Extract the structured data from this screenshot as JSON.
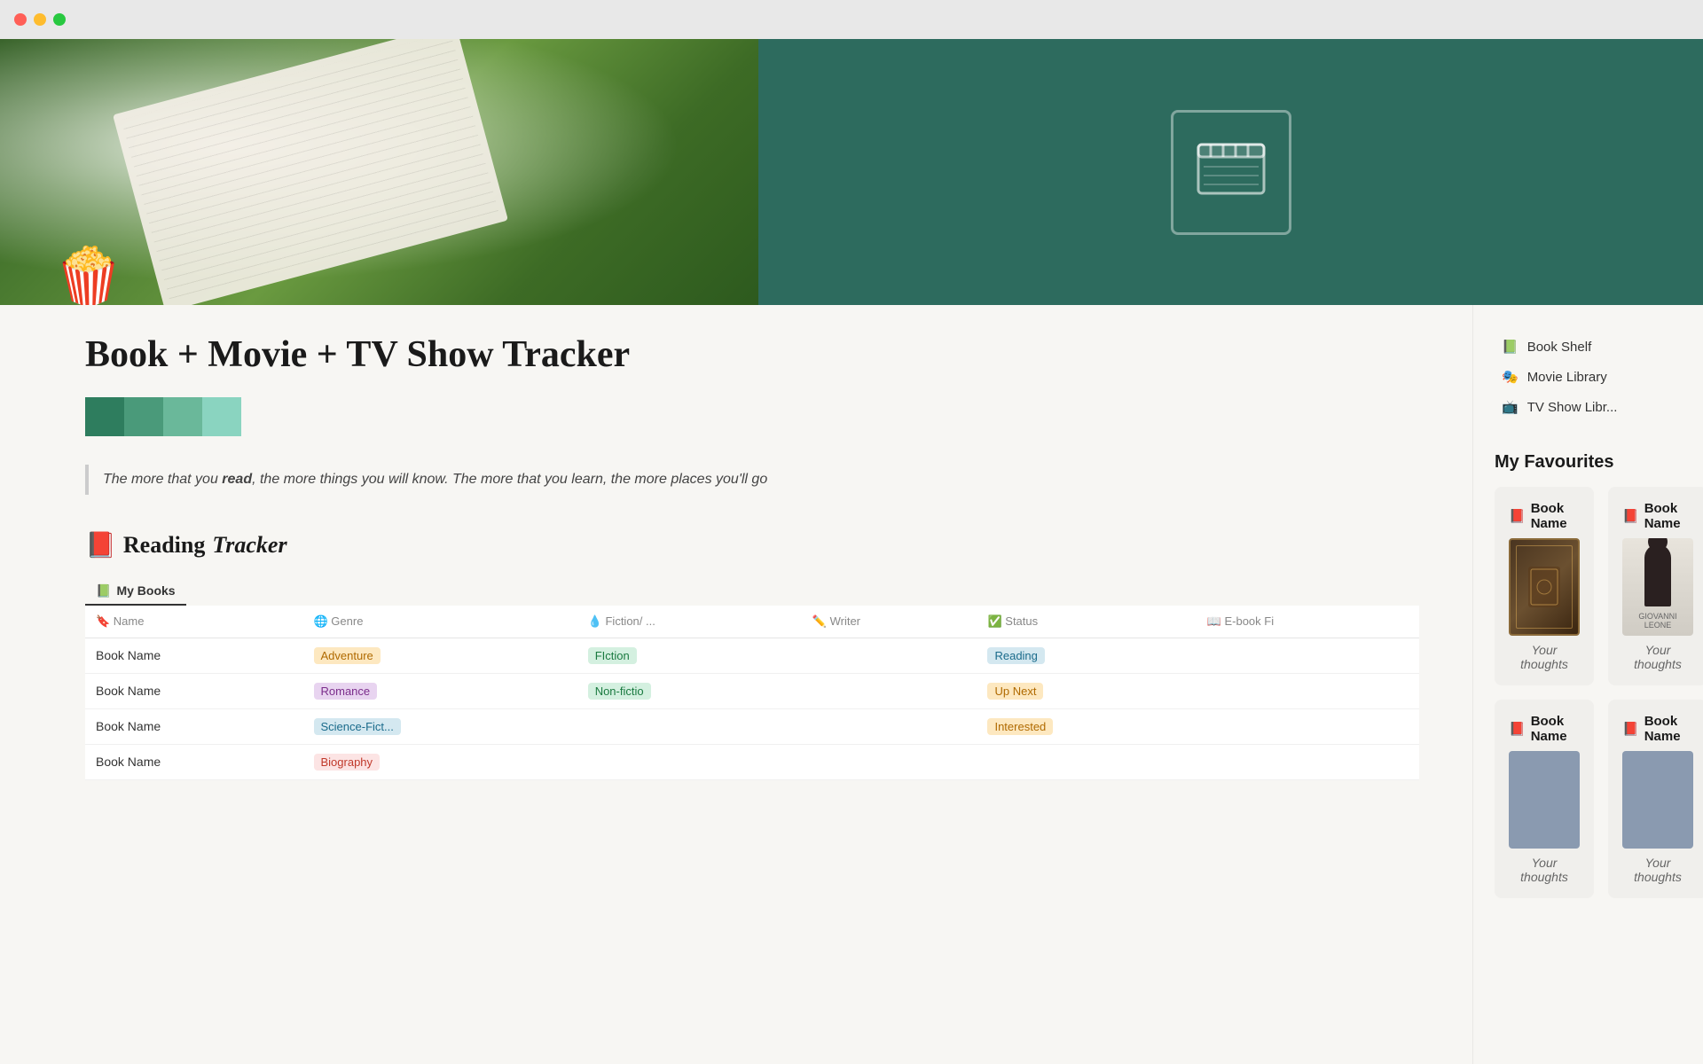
{
  "titlebar": {
    "dots": [
      "red",
      "yellow",
      "green"
    ]
  },
  "hero": {
    "popcorn_emoji": "🍿",
    "movie_icon_label": "🎬"
  },
  "page": {
    "title": "Book  + Movie + TV Show Tracker",
    "color_swatches": [
      "#2e7d5e",
      "#4a9a7a",
      "#6ab89a",
      "#8ad4c0"
    ],
    "quote": "The more that you read, the more things you will know. The more that you learn, the more places you'll go",
    "quote_bold": "read"
  },
  "sidebar_nav": {
    "items": [
      {
        "icon": "📗",
        "label": "Book Shelf"
      },
      {
        "icon": "🎭",
        "label": "Movie Library"
      },
      {
        "icon": "📺",
        "label": "TV Show Libr..."
      }
    ]
  },
  "reading_tracker": {
    "section_emoji": "📕",
    "section_text": "Reading ",
    "section_italic": "Tracker",
    "tab_icon": "📗",
    "tab_label": "My Books",
    "columns": [
      "Name",
      "Genre",
      "Fiction/ ...",
      "Writer",
      "Status",
      "E-book Fi"
    ],
    "col_icons": [
      "🔖",
      "🌐",
      "💧",
      "✏️",
      "✅",
      "📖"
    ],
    "rows": [
      {
        "name": "Book Name",
        "genre": "Adventure",
        "genre_class": "tag-adventure",
        "fiction": "FIction",
        "fiction_class": "tag-fiction",
        "writer": "",
        "status": "Reading",
        "status_class": "tag-reading",
        "ebook": ""
      },
      {
        "name": "Book Name",
        "genre": "Romance",
        "genre_class": "tag-romance",
        "fiction": "Non-fictio",
        "fiction_class": "tag-nonfiction",
        "writer": "",
        "status": "Up Next",
        "status_class": "tag-upnext",
        "ebook": ""
      },
      {
        "name": "Book Name",
        "genre": "Science-Fict...",
        "genre_class": "tag-scifi",
        "fiction": "",
        "fiction_class": "",
        "writer": "",
        "status": "Interested",
        "status_class": "tag-interested",
        "ebook": ""
      },
      {
        "name": "Book Name",
        "genre": "Biography",
        "genre_class": "tag-biography",
        "fiction": "",
        "fiction_class": "",
        "writer": "",
        "status": "",
        "status_class": "",
        "ebook": ""
      }
    ]
  },
  "favourites": {
    "title": "My Favourites",
    "cards": [
      {
        "emoji": "📕",
        "title": "Book Name",
        "cover_type": "ornate",
        "thoughts": "Your thoughts"
      },
      {
        "emoji": "📕",
        "title": "Book Name",
        "cover_type": "person",
        "thoughts": "Your thoughts"
      },
      {
        "emoji": "📕",
        "title": "Book Name",
        "cover_type": "plain",
        "thoughts": "Your thoughts"
      },
      {
        "emoji": "📕",
        "title": "Book Name",
        "cover_type": "plain2",
        "thoughts": "Your thoughts"
      }
    ]
  }
}
